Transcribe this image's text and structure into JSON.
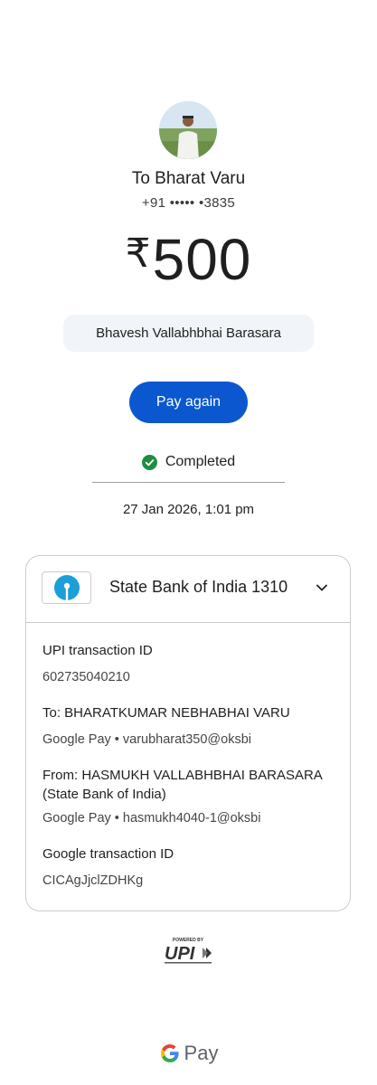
{
  "recipient": {
    "name": "To Bharat Varu",
    "phone": "+91 ••••• •3835"
  },
  "amount": {
    "currency_symbol": "₹",
    "value": "500"
  },
  "note": "Bhavesh Vallabhbhai Barasara",
  "actions": {
    "pay_again_label": "Pay again"
  },
  "status": {
    "label": "Completed",
    "color": "#1e8e3e"
  },
  "datetime": "27 Jan 2026, 1:01 pm",
  "bank": {
    "name": "State Bank of India 1310",
    "logo_icon": "sbi-logo-icon",
    "brand_color": "#1a9fd9"
  },
  "details": {
    "upi_txn_label": "UPI transaction ID",
    "upi_txn_value": "602735040210",
    "to_label": "To: BHARATKUMAR NEBHABHAI VARU",
    "to_value": "Google Pay • varubharat350@oksbi",
    "from_label": "From: HASMUKH VALLABHBHAI BARASARA (State Bank of India)",
    "from_value": "Google Pay • hasmukh4040-1@oksbi",
    "google_txn_label": "Google transaction ID",
    "google_txn_value": "CICAgJjclZDHKg"
  },
  "footer": {
    "upi_powered_by": "POWERED BY",
    "upi_text": "UPI",
    "gpay_text": "Pay"
  },
  "colors": {
    "accent": "#0b57d0"
  }
}
